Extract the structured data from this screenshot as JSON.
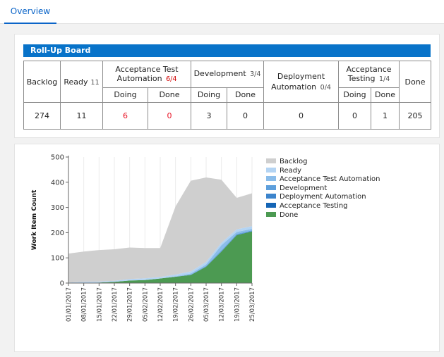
{
  "tabs": [
    {
      "label": "Overview",
      "active": true
    }
  ],
  "board": {
    "title": "Roll-Up Board",
    "columns": {
      "backlog": {
        "label": "Backlog",
        "count": "274"
      },
      "ready": {
        "label": "Ready",
        "limit": "11"
      },
      "ata": {
        "label_line1": "Acceptance Test",
        "label_line2": "Automation",
        "limit": "6/4",
        "doing_label": "Doing",
        "done_label": "Done",
        "doing": "6",
        "done": "0"
      },
      "dev": {
        "label": "Development",
        "limit": "3/4",
        "doing_label": "Doing",
        "done_label": "Done",
        "doing": "3",
        "done": "0"
      },
      "deploy": {
        "label_line1": "Deployment",
        "label_line2": "Automation",
        "limit": "0/4",
        "count": "0"
      },
      "at": {
        "label_line1": "Acceptance",
        "label_line2": "Testing",
        "limit": "1/4",
        "doing_label": "Doing",
        "done_label": "Done",
        "doing": "0",
        "done": "1"
      },
      "done": {
        "label": "Done",
        "count": "205"
      }
    },
    "ready_count": "11",
    "colors": {
      "header_bg": "#0873c9",
      "over_limit": "#e81123"
    }
  },
  "chart_data": {
    "type": "area",
    "stacked": true,
    "ylabel": "Work Item Count",
    "xlabel": "",
    "ylim": [
      0,
      500
    ],
    "yticks": [
      0,
      100,
      200,
      300,
      400,
      500
    ],
    "grid": true,
    "legend_position": "right",
    "x": [
      "01/01/2017",
      "08/01/2017",
      "15/01/2017",
      "22/01/2017",
      "29/01/2017",
      "05/02/2017",
      "12/02/2017",
      "19/02/2017",
      "26/02/2017",
      "05/03/2017",
      "12/03/2017",
      "19/03/2017",
      "25/03/2017"
    ],
    "series": [
      {
        "name": "Backlog",
        "color": "#cfcfcf",
        "values": [
          115,
          120,
          125,
          125,
          125,
          120,
          115,
          270,
          360,
          335,
          250,
          125,
          130
        ]
      },
      {
        "name": "Ready",
        "color": "#b4d4f3",
        "values": [
          2,
          4,
          4,
          4,
          6,
          7,
          6,
          7,
          8,
          10,
          10,
          10,
          11
        ]
      },
      {
        "name": "Acceptance Test Automation",
        "color": "#8bbdea",
        "values": [
          0,
          0,
          0,
          0,
          0,
          0,
          0,
          2,
          4,
          6,
          20,
          8,
          6
        ]
      },
      {
        "name": "Development",
        "color": "#5e9fdc",
        "values": [
          0,
          0,
          0,
          0,
          0,
          0,
          0,
          0,
          2,
          3,
          5,
          4,
          3
        ]
      },
      {
        "name": "Deployment Automation",
        "color": "#3c84cc",
        "values": [
          0,
          0,
          0,
          0,
          0,
          0,
          0,
          0,
          0,
          0,
          0,
          0,
          0
        ]
      },
      {
        "name": "Acceptance Testing",
        "color": "#1565b5",
        "values": [
          0,
          0,
          0,
          0,
          0,
          0,
          0,
          0,
          0,
          0,
          0,
          1,
          1
        ]
      },
      {
        "name": "Done",
        "color": "#4c9a52",
        "values": [
          0,
          1,
          2,
          5,
          10,
          12,
          18,
          25,
          32,
          65,
          125,
          190,
          205
        ]
      }
    ]
  }
}
